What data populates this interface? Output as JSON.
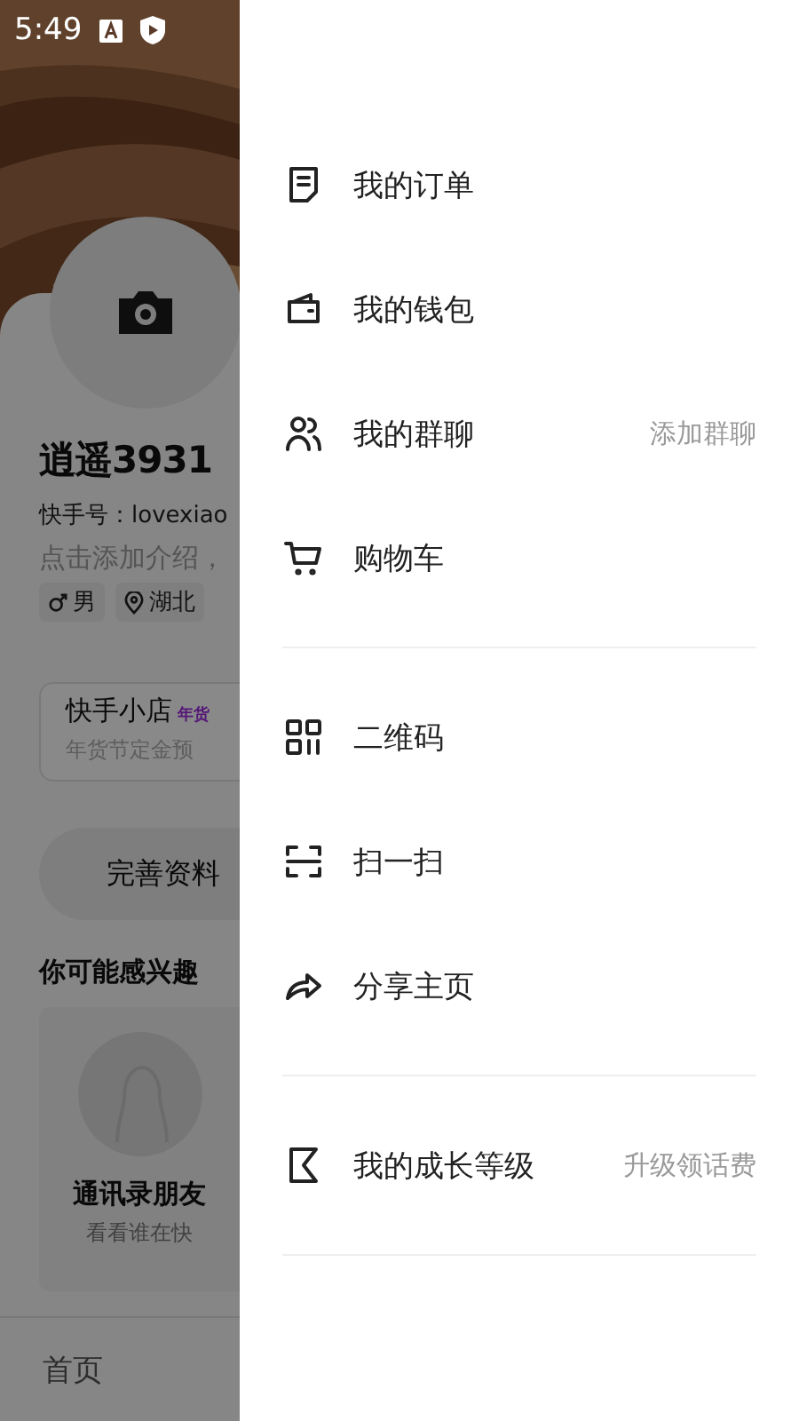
{
  "status_bar": {
    "time": "5:49"
  },
  "profile": {
    "name": "逍遥3931",
    "id_line": "快手号：lovexiao",
    "intro": "点击添加介绍，",
    "tags": [
      {
        "kind": "gender",
        "label": "男"
      },
      {
        "kind": "location",
        "label": "湖北"
      }
    ],
    "shop": {
      "title": "快手小店",
      "badge": "年货",
      "subtitle": "年货节定金预"
    },
    "complete_button": "完善资料",
    "suggest_title": "你可能感兴趣",
    "suggest_card": {
      "title": "通讯录朋友",
      "subtitle": "看看谁在快"
    }
  },
  "bottom_nav": {
    "items": [
      {
        "label": "首页",
        "selected": false
      }
    ]
  },
  "drawer": {
    "sections": [
      {
        "items": [
          {
            "kind": "order",
            "label": "我的订单"
          },
          {
            "kind": "wallet",
            "label": "我的钱包"
          },
          {
            "kind": "group",
            "label": "我的群聊",
            "hint": "添加群聊"
          },
          {
            "kind": "cart",
            "label": "购物车"
          }
        ]
      },
      {
        "items": [
          {
            "kind": "qr",
            "label": "二维码"
          },
          {
            "kind": "scan",
            "label": "扫一扫"
          },
          {
            "kind": "share",
            "label": "分享主页"
          }
        ]
      },
      {
        "items": [
          {
            "kind": "level",
            "label": "我的成长等级",
            "hint": "升级领话费"
          }
        ]
      }
    ]
  }
}
